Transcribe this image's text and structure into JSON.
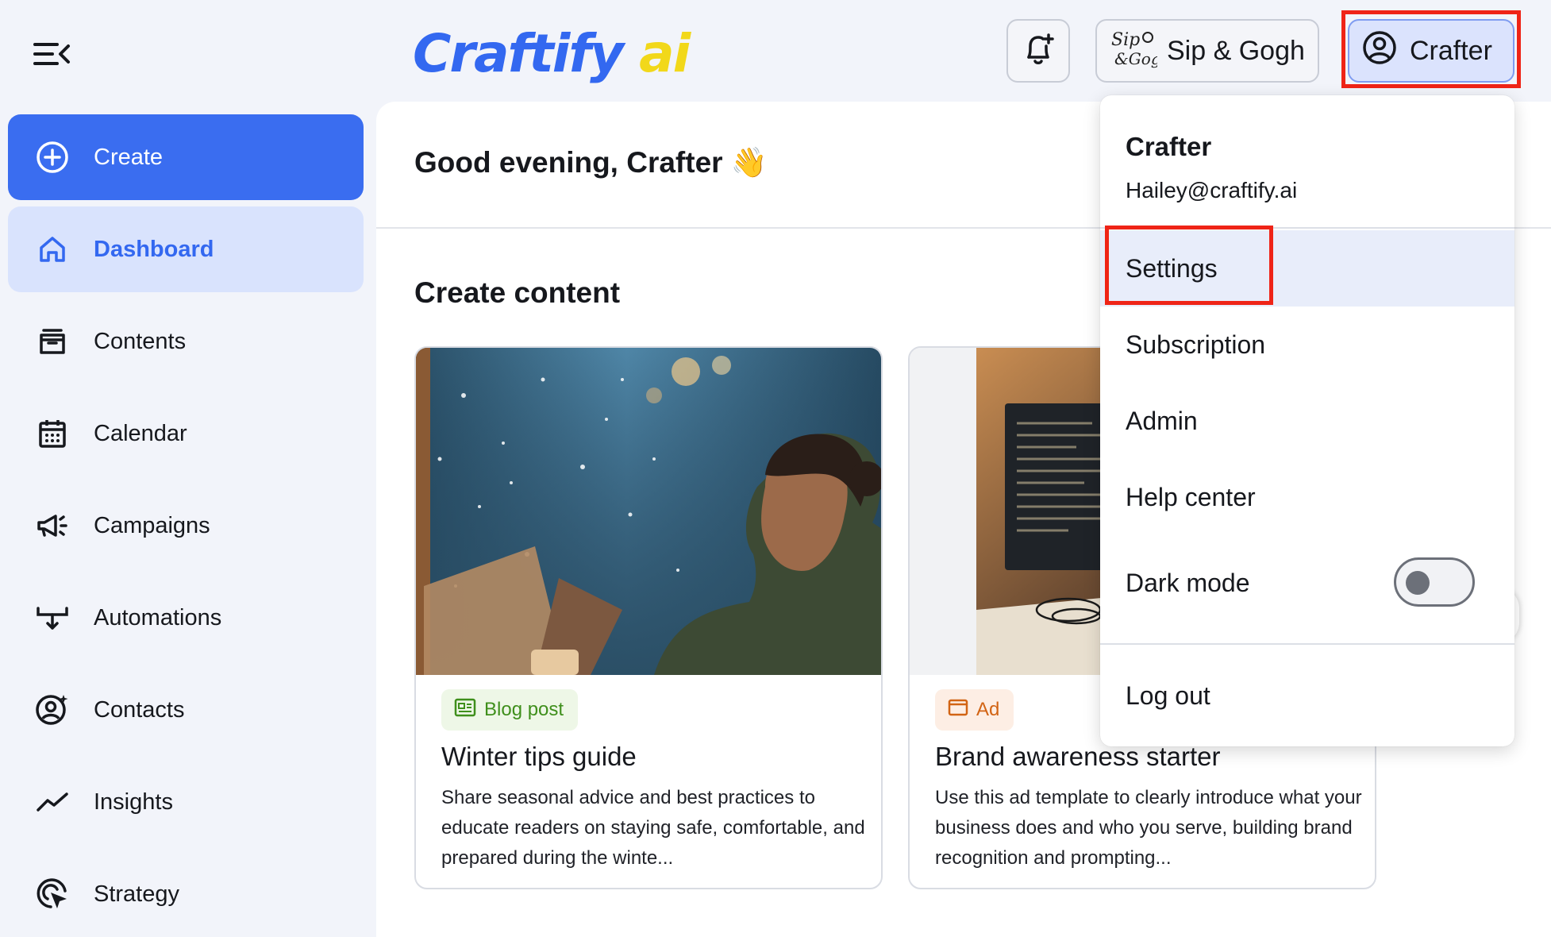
{
  "header": {
    "logo_part1": "Craftify",
    "logo_part2": "ai",
    "workspace_label": "Sip & Gogh",
    "user_label": "Crafter"
  },
  "sidebar": {
    "items": [
      {
        "label": "Create",
        "icon": "plus-circle-icon"
      },
      {
        "label": "Dashboard",
        "icon": "home-icon"
      },
      {
        "label": "Contents",
        "icon": "archive-icon"
      },
      {
        "label": "Calendar",
        "icon": "calendar-icon"
      },
      {
        "label": "Campaigns",
        "icon": "megaphone-icon"
      },
      {
        "label": "Automations",
        "icon": "automation-icon"
      },
      {
        "label": "Contacts",
        "icon": "contacts-icon"
      },
      {
        "label": "Insights",
        "icon": "trend-icon"
      },
      {
        "label": "Strategy",
        "icon": "target-cursor-icon"
      }
    ]
  },
  "main": {
    "greeting": "Good evening, Crafter 👋",
    "section_title": "Create content",
    "cards": [
      {
        "badge": "Blog post",
        "title": "Winter tips guide",
        "desc": "Share seasonal advice and best practices to educate readers on staying safe, comfortable, and prepared during the winte..."
      },
      {
        "badge": "Ad",
        "title": "Brand awareness starter",
        "desc": "Use this ad template to clearly introduce what your business does and who you serve, building brand recognition and prompting..."
      }
    ]
  },
  "dropdown": {
    "name": "Crafter",
    "email": "Hailey@craftify.ai",
    "items": [
      "Settings",
      "Subscription",
      "Admin",
      "Help center"
    ],
    "dark_mode_label": "Dark mode",
    "dark_mode_on": false,
    "logout": "Log out"
  },
  "colors": {
    "accent": "#3a6df0",
    "logo_yellow": "#f2d81a",
    "highlight": "#ef2417"
  }
}
